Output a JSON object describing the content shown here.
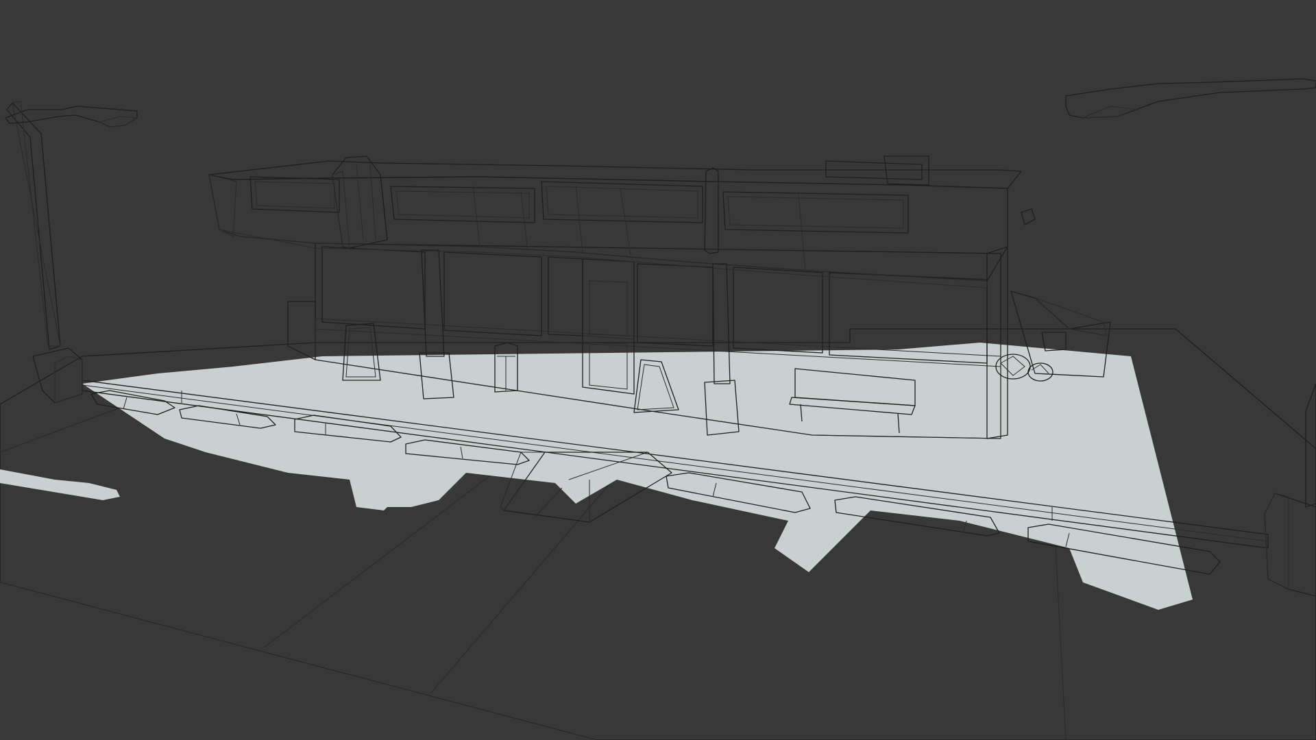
{
  "viewport": {
    "background_color": "#383838",
    "ground_color": "#ffffff",
    "shadow_color": "#c8d0d0",
    "model_light": "#b4b4b4",
    "model_mid": "#9c9c9c",
    "model_dark": "#7e7e7e",
    "wire_color": "#1e1e1e"
  },
  "scene": {
    "objects": [
      "ground-plane",
      "sidewalk",
      "road-curb",
      "store-building",
      "canopy",
      "pillar",
      "street-lamp",
      "parking-stop",
      "a-frame-sign",
      "trash-can",
      "bench",
      "dumpster",
      "trash-bags",
      "wheelchair-ramp"
    ]
  }
}
